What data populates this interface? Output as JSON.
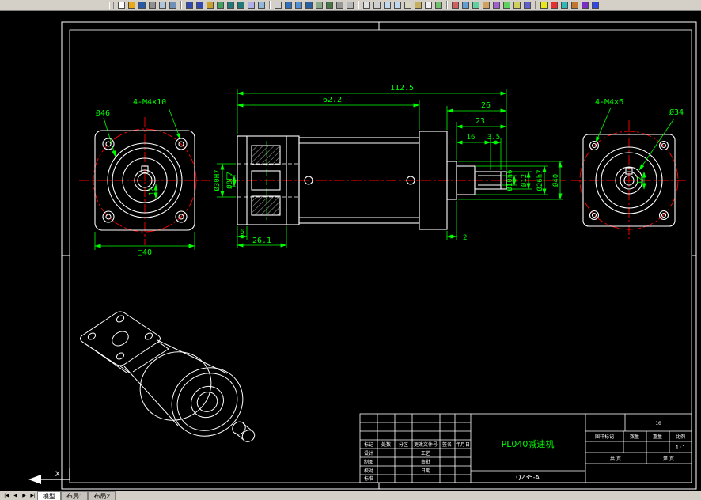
{
  "window": {
    "toolbar_bg": "#d4d0c8",
    "canvas_bg": "#000000"
  },
  "colors": {
    "dimension_green": "#00ff00",
    "centerline_red": "#ff0000",
    "geometry_white": "#ffffff"
  },
  "toolbar": {
    "groups": [
      [
        {
          "name": "new",
          "color": "#ffffff"
        },
        {
          "name": "open",
          "color": "#e8a818"
        },
        {
          "name": "save",
          "color": "#2858a8"
        },
        {
          "name": "plot",
          "color": "#909090"
        },
        {
          "name": "plot-preview",
          "color": "#b0c4d8"
        },
        {
          "name": "publish",
          "color": "#7090b8"
        }
      ],
      [
        {
          "name": "cut",
          "color": "#3048b0"
        },
        {
          "name": "copy",
          "color": "#3048b0"
        },
        {
          "name": "paste",
          "color": "#c8a030"
        },
        {
          "name": "match-properties",
          "color": "#40a060"
        },
        {
          "name": "undo",
          "color": "#207878"
        },
        {
          "name": "redo",
          "color": "#207878"
        },
        {
          "name": "find",
          "color": "#b0b0e8"
        },
        {
          "name": "spell",
          "color": "#90b8d8"
        }
      ],
      [
        {
          "name": "pan",
          "color": "#d0d0d0"
        },
        {
          "name": "zoom-realtime",
          "color": "#3070c0"
        },
        {
          "name": "zoom-window",
          "color": "#5090d8"
        },
        {
          "name": "zoom-previous",
          "color": "#2860a0"
        },
        {
          "name": "named-views",
          "color": "#88a888"
        },
        {
          "name": "orbit-3d",
          "color": "#487848"
        },
        {
          "name": "regen",
          "color": "#989898"
        },
        {
          "name": "redraw",
          "color": "#b8b8b8"
        }
      ],
      [
        {
          "name": "line",
          "color": "#e0e0e0"
        },
        {
          "name": "polyline",
          "color": "#d0d0d0"
        },
        {
          "name": "circle",
          "color": "#c0d8f0"
        },
        {
          "name": "arc",
          "color": "#c0d8f0"
        },
        {
          "name": "rectangle",
          "color": "#d8d8c0"
        },
        {
          "name": "hatch",
          "color": "#c8b060"
        },
        {
          "name": "text",
          "color": "#f0f0f0"
        },
        {
          "name": "dimension",
          "color": "#70c070"
        }
      ],
      [
        {
          "name": "erase",
          "color": "#d06060"
        },
        {
          "name": "move",
          "color": "#60a0d0"
        },
        {
          "name": "rotate",
          "color": "#60d0a0"
        },
        {
          "name": "scale",
          "color": "#d0a060"
        },
        {
          "name": "trim",
          "color": "#a060d0"
        },
        {
          "name": "extend",
          "color": "#60d060"
        },
        {
          "name": "offset",
          "color": "#d0d060"
        },
        {
          "name": "mirror",
          "color": "#6060d0"
        }
      ],
      [
        {
          "name": "layers",
          "color": "#e8e818"
        },
        {
          "name": "layer-color",
          "color": "#e83030"
        },
        {
          "name": "properties",
          "color": "#30b8b8"
        },
        {
          "name": "design-center",
          "color": "#c07830"
        },
        {
          "name": "tool-palettes",
          "color": "#7830c0"
        },
        {
          "name": "help",
          "color": "#3048e8"
        }
      ]
    ]
  },
  "canvas": {
    "ucs_label": "X",
    "front": {
      "d46": "Ø46",
      "m4": "4-M4×10",
      "sq40": "□40",
      "k12": "12"
    },
    "side": {
      "l1125": "112.5",
      "l622": "62.2",
      "l26": "26",
      "l23": "23",
      "l16": "16",
      "l35": "3.5",
      "d30": "Ø30H7",
      "d8": "Ø8F7",
      "d10": "Ø10h6",
      "d12": "Ø12",
      "d26": "Ø26h7",
      "d40": "Ø40",
      "b6": "6",
      "b261": "26.1",
      "b2": "2"
    },
    "rear": {
      "m4": "4-M4×6",
      "d34": "Ø34",
      "k12": "12"
    },
    "title_block": {
      "part_name": "PL040减速机",
      "material": "Q235-A",
      "top_num": "10",
      "header": [
        "标记",
        "处数",
        "分区",
        "更改文件号",
        "签名",
        "年月日"
      ],
      "col1": [
        "设计",
        "制图",
        "校对",
        "标准"
      ],
      "col2": [
        "工艺",
        "审批",
        "日期"
      ],
      "right_header": [
        "图样标记",
        "数量",
        "重量",
        "比例"
      ],
      "scale": "1:1",
      "sheet_left": "共  页",
      "sheet_right": "第  页"
    }
  },
  "statusbar": {
    "nav": [
      "|◀",
      "◀",
      "▶",
      "▶|"
    ],
    "tabs": [
      {
        "label": "模型",
        "active": true
      },
      {
        "label": "布局1",
        "active": false
      },
      {
        "label": "布局2",
        "active": false
      }
    ]
  }
}
